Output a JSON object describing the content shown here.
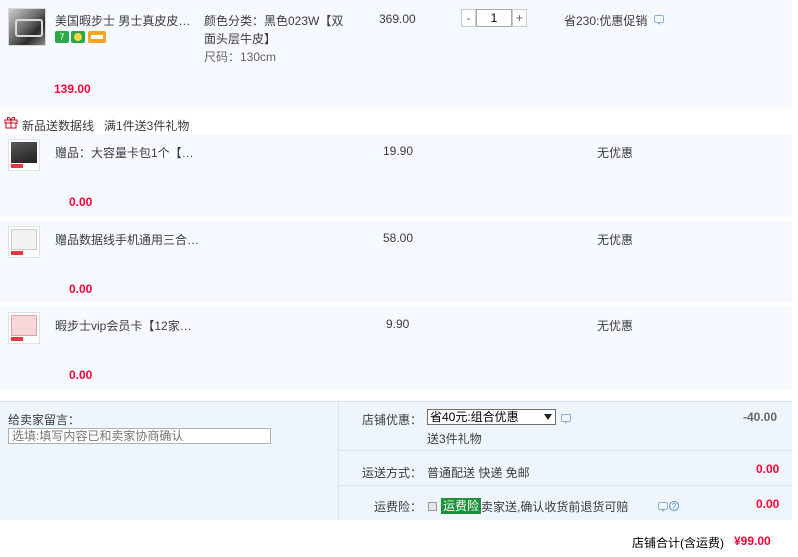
{
  "main_item": {
    "title": "美国暇步士 男士真皮皮…",
    "sku_line1": "颜色分类：黑色023W【双",
    "sku_line2": "面头层牛皮】",
    "sku_line3": "尺码：130cm",
    "price": "369.00",
    "quantity": "1",
    "qty_minus": "-",
    "qty_plus": "+",
    "promo": "省230:优惠促销",
    "subtotal": "139.00",
    "service_icons": [
      {
        "name": "7-day-return-icon",
        "label": "7",
        "color": "#2ba84a"
      },
      {
        "name": "guarantee-icon",
        "label": "",
        "color": "#f5a623"
      },
      {
        "name": "credit-card-icon",
        "label": "",
        "color": "#f5a623"
      }
    ]
  },
  "gift_banner": {
    "icon": "gift-icon",
    "text": "新品送数据线",
    "rule": "满1件送3件礼物"
  },
  "gifts": [
    {
      "title": "赠品：大容量卡包1个【…",
      "price": "19.90",
      "promo": "无优惠",
      "subtotal": "0.00"
    },
    {
      "title": "赠品数据线手机通用三合…",
      "price": "58.00",
      "promo": "无优惠",
      "subtotal": "0.00"
    },
    {
      "title": "暇步士vip会员卡【12家…",
      "price": "9.90",
      "promo": "无优惠",
      "subtotal": "0.00"
    }
  ],
  "order": {
    "memo_label": "给卖家留言：",
    "memo_placeholder": "选填:填写内容已和卖家协商确认",
    "shop_discount_label": "店铺优惠：",
    "shop_discount_selected": "省40元:组合优惠",
    "shop_discount_note": "送3件礼物",
    "shop_discount_value": "-40.00",
    "shipping_label": "运送方式：",
    "shipping_method": "普通配送 快递 免邮",
    "shipping_value": "0.00",
    "insurance_label": "运费险：",
    "insurance_badge": "运费险",
    "insurance_text": "卖家送,确认收货前退货可赔",
    "insurance_value": "0.00",
    "total_label": "店铺合计(含运费)",
    "total_value": "¥99.00"
  },
  "colors": {
    "accent_red": "#ff0036",
    "row_bg": "#f6f9ff",
    "panel_bg": "#eef5fc",
    "insurance_green": "#1e8f3a"
  }
}
